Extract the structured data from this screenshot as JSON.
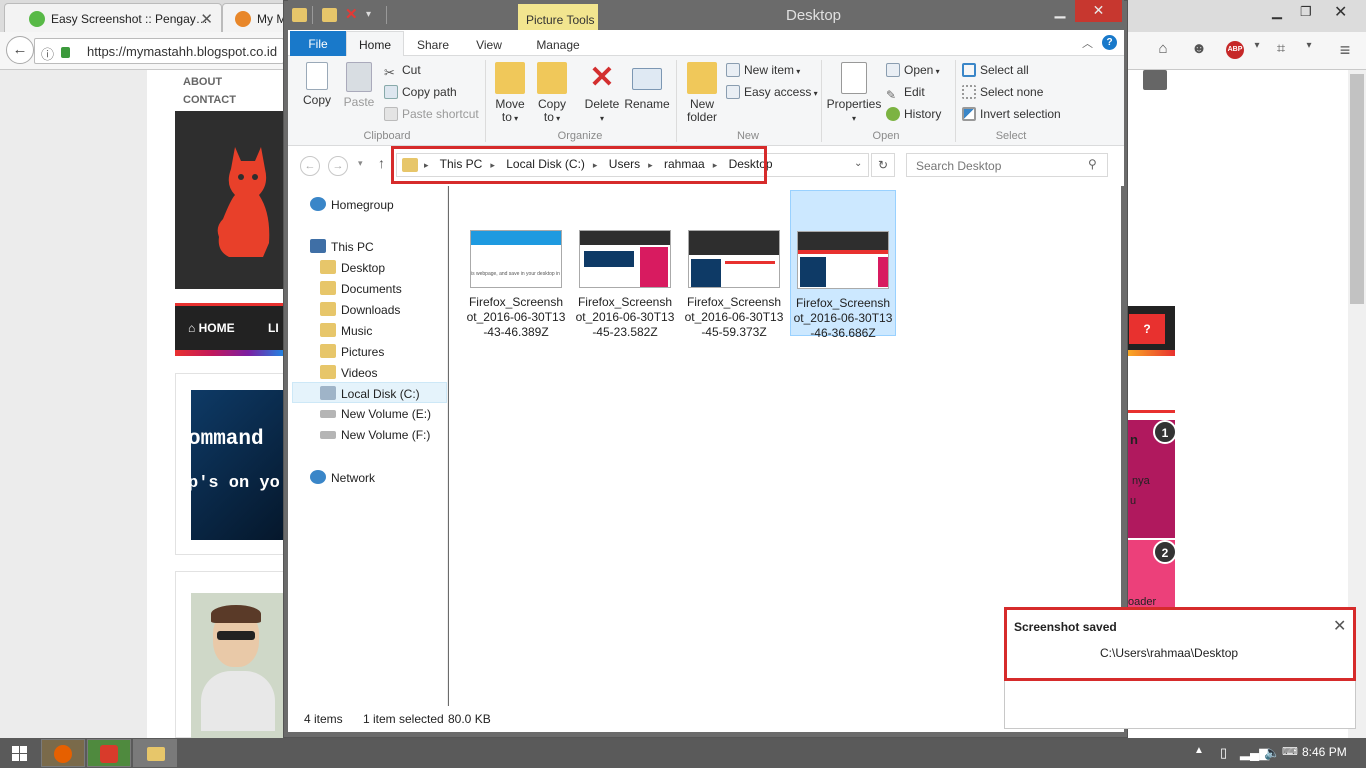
{
  "browser": {
    "tabs": [
      {
        "title": "Easy Screenshot :: Pengay…"
      },
      {
        "title": "My M"
      }
    ],
    "url": "https://mymastahh.blogspot.co.id"
  },
  "blog": {
    "nav": [
      "ABOUT",
      "CONTACT"
    ],
    "menu_home": "HOME",
    "menu_next": "LI",
    "help_button": "?",
    "card_text_1": "ommand",
    "card_text_2": "p's on yo",
    "side_rank_1": "1",
    "side_rank_2": "2",
    "side_text_1": "n",
    "side_text_2": "nya",
    "side_text_3": "u",
    "side_text_4": "oader"
  },
  "explorer": {
    "title": "Desktop",
    "context_tab": "Picture Tools",
    "tabs": {
      "file": "File",
      "home": "Home",
      "share": "Share",
      "view": "View",
      "manage": "Manage"
    },
    "clipboard": {
      "copy": "Copy",
      "paste": "Paste",
      "cut": "Cut",
      "copy_path": "Copy path",
      "paste_shortcut": "Paste shortcut",
      "label": "Clipboard"
    },
    "organize": {
      "move_to_1": "Move",
      "move_to_2": "to",
      "copy_to_1": "Copy",
      "copy_to_2": "to",
      "delete": "Delete",
      "rename": "Rename",
      "label": "Organize"
    },
    "new": {
      "new_folder_1": "New",
      "new_folder_2": "folder",
      "new_item": "New item",
      "easy_access": "Easy access",
      "label": "New"
    },
    "open": {
      "properties": "Properties",
      "open": "Open",
      "edit": "Edit",
      "history": "History",
      "label": "Open"
    },
    "select": {
      "select_all": "Select all",
      "select_none": "Select none",
      "invert": "Invert selection",
      "label": "Select"
    },
    "address": {
      "crumbs": [
        "This PC",
        "Local Disk (C:)",
        "Users",
        "rahmaa",
        "Desktop"
      ]
    },
    "search_placeholder": "Search Desktop",
    "nav": {
      "homegroup": "Homegroup",
      "this_pc": "This PC",
      "desktop": "Desktop",
      "documents": "Documents",
      "downloads": "Downloads",
      "music": "Music",
      "pictures": "Pictures",
      "videos": "Videos",
      "local_disk": "Local Disk (C:)",
      "vol_e": "New Volume (E:)",
      "vol_f": "New Volume (F:)",
      "network": "Network"
    },
    "files": [
      {
        "l1": "Firefox_Screensh",
        "l2": "ot_2016-06-30T13",
        "l3": "-43-46.389Z"
      },
      {
        "l1": "Firefox_Screensh",
        "l2": "ot_2016-06-30T13",
        "l3": "-45-23.582Z"
      },
      {
        "l1": "Firefox_Screensh",
        "l2": "ot_2016-06-30T13",
        "l3": "-45-59.373Z"
      },
      {
        "l1": "Firefox_Screensh",
        "l2": "ot_2016-06-30T13",
        "l3": "-46-36.686Z"
      }
    ],
    "thumb1_text": "is webpage, and save in your desktop in de",
    "status": {
      "count": "4 items",
      "selected": "1 item selected",
      "size": "80.0 KB"
    }
  },
  "toast": {
    "title": "Screenshot saved",
    "path": "C:\\Users\\rahmaa\\Desktop"
  },
  "taskbar": {
    "clock": "8:46 PM"
  },
  "colors": {
    "highlight_red": "#d62b2b",
    "ribbon_file_blue": "#1979ca",
    "picture_tools_yellow": "#f2e58f",
    "selection_blue": "#cce8ff"
  }
}
